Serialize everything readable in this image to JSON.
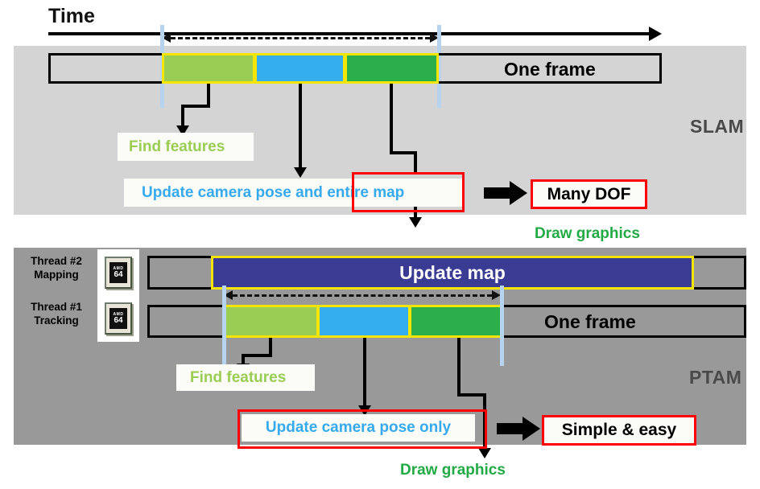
{
  "diagram": {
    "time_axis": {
      "label": "Time"
    },
    "slam": {
      "panel_title": "SLAM",
      "frame_label": "One frame",
      "segments": [
        {
          "name": "find-features",
          "color": "#9acd53"
        },
        {
          "name": "update-pose",
          "color": "#35aeee"
        },
        {
          "name": "update-map",
          "color": "#2baf4b"
        }
      ],
      "callouts": {
        "find_features": "Find features",
        "update_pose_map_prefix": "Update camera pose and ",
        "update_pose_map_highlight": "entire map",
        "update_pose_map_full": "Update camera pose and entire map",
        "result": "Many DOF",
        "draw_graphics": "Draw graphics"
      }
    },
    "ptam": {
      "panel_title": "PTAM",
      "frame_label": "One frame",
      "threads": [
        {
          "line1": "Thread #2",
          "line2": "Mapping",
          "icon": "cpu-chip-icon",
          "chip_brand": "AMD",
          "chip_model": "64"
        },
        {
          "line1": "Thread #1",
          "line2": "Tracking",
          "icon": "cpu-chip-icon",
          "chip_brand": "AMD",
          "chip_model": "64"
        }
      ],
      "mapping_bar_label": "Update map",
      "segments": [
        {
          "name": "find-features",
          "color": "#9acd53"
        },
        {
          "name": "update-pose",
          "color": "#35aeee"
        },
        {
          "name": "draw-graphics",
          "color": "#2baf4b"
        }
      ],
      "callouts": {
        "find_features": "Find features",
        "update_pose_only": "Update camera pose only",
        "result": "Simple & easy",
        "draw_graphics": "Draw graphics"
      }
    },
    "colors": {
      "light_green": "#9acd53",
      "cyan_blue": "#35aeee",
      "dark_green": "#2baf4b",
      "indigo": "#3a3c94",
      "segment_border": "#f5e500",
      "red_highlight": "#ff0000",
      "guide_blue": "#b6d4ee",
      "slam_panel_bg": "#d4d4d4",
      "ptam_panel_bg": "#999999",
      "text_green": "#22aa44"
    }
  }
}
